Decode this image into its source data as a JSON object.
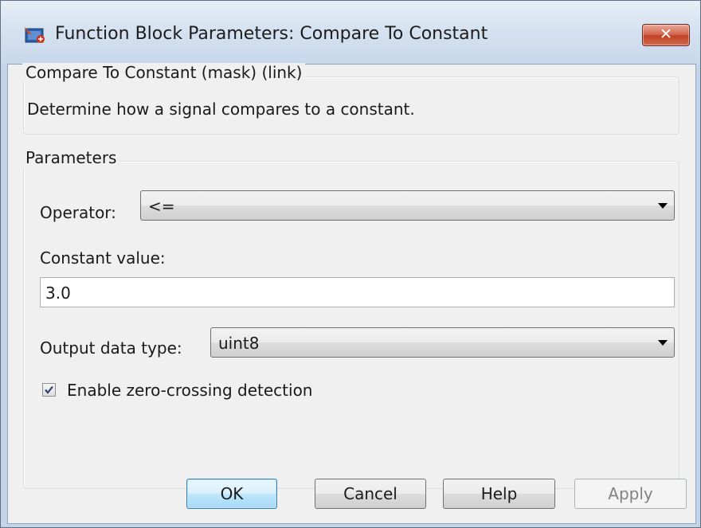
{
  "window": {
    "title": "Function Block Parameters: Compare To Constant",
    "close_glyph": "✕"
  },
  "mask_group": {
    "legend": "Compare To Constant (mask) (link)",
    "description": "Determine how a signal compares to a constant."
  },
  "parameters_group": {
    "legend": "Parameters",
    "operator": {
      "label": "Operator:",
      "value": "<="
    },
    "constant": {
      "label": "Constant value:",
      "value": "3.0"
    },
    "output_type": {
      "label": "Output data type:",
      "value": "uint8"
    },
    "zero_crossing": {
      "label": "Enable zero-crossing detection",
      "checked": true
    }
  },
  "buttons": {
    "ok": "OK",
    "cancel": "Cancel",
    "help": "Help",
    "apply": "Apply"
  },
  "colors": {
    "titlebar": "#d6e2f0",
    "close_button": "#c24327",
    "default_button_border": "#3c7fb1",
    "dialog_background": "#f0f0f0"
  }
}
